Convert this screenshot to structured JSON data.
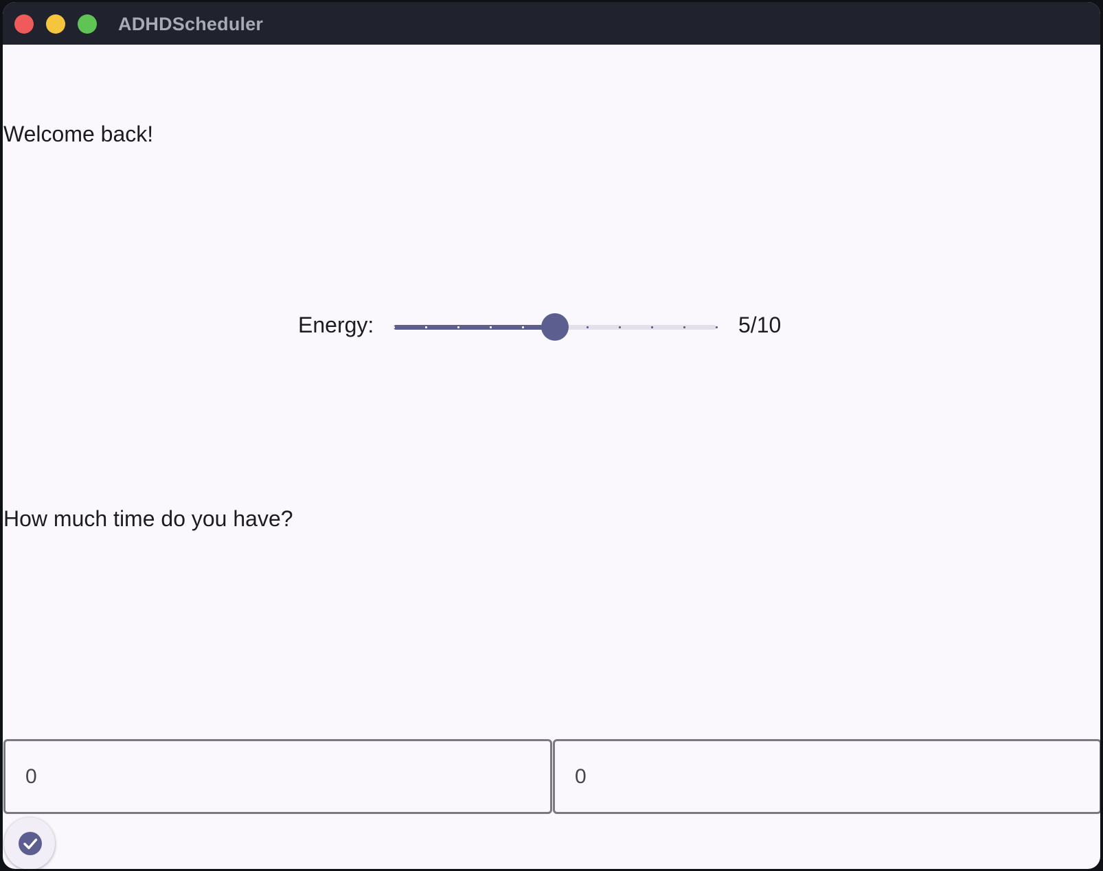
{
  "window": {
    "title": "ADHDScheduler",
    "controls": {
      "close_color": "#ee5b5a",
      "minimize_color": "#f4c53d",
      "maximize_color": "#5fc454"
    }
  },
  "main": {
    "welcome_text": "Welcome back!",
    "energy": {
      "label": "Energy:",
      "value": 5,
      "min": 0,
      "max": 10,
      "display": "5/10"
    },
    "time_question": "How much time do you have?",
    "time_inputs": {
      "first_value": "0",
      "second_value": "0"
    },
    "fab_icon": "check-circle-icon"
  },
  "colors": {
    "accent": "#5b5e8e",
    "track_inactive": "#e3e0ec",
    "background": "#fbf8fd",
    "titlebar": "#20222e",
    "field_border": "#7a7880"
  }
}
